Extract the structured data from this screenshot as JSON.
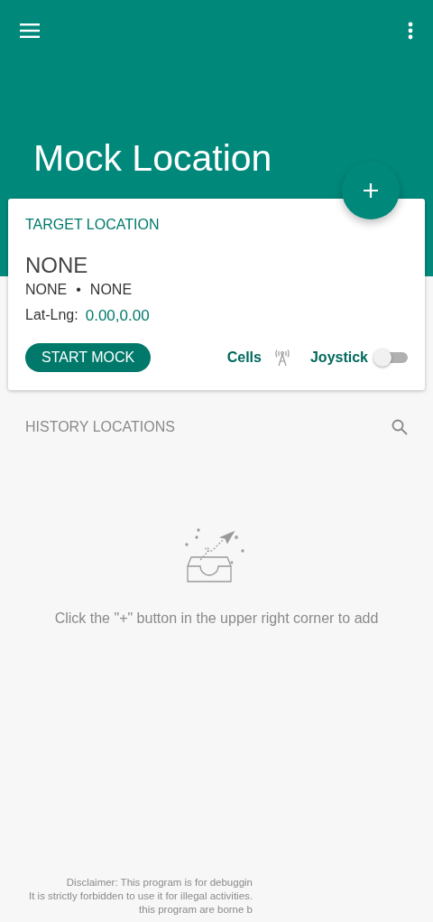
{
  "header": {
    "title": "Mock Location"
  },
  "target": {
    "heading": "TARGET LOCATION",
    "name": "NONE",
    "region": "NONE",
    "separator": "•",
    "country": "NONE",
    "latlng_label": "Lat-Lng:",
    "latlng_value": "0.00,0.00",
    "start_button": "START MOCK",
    "cells_label": "Cells",
    "joystick_label": "Joystick",
    "joystick_on": false
  },
  "history": {
    "heading": "HISTORY LOCATIONS",
    "empty_message": "Click the \"+\" button in the upper right corner to add"
  },
  "disclaimer": [
    "Disclaimer: This program is for debuggin",
    "It is strictly forbidden to use it for illegal activities.",
    "this program are borne b"
  ]
}
